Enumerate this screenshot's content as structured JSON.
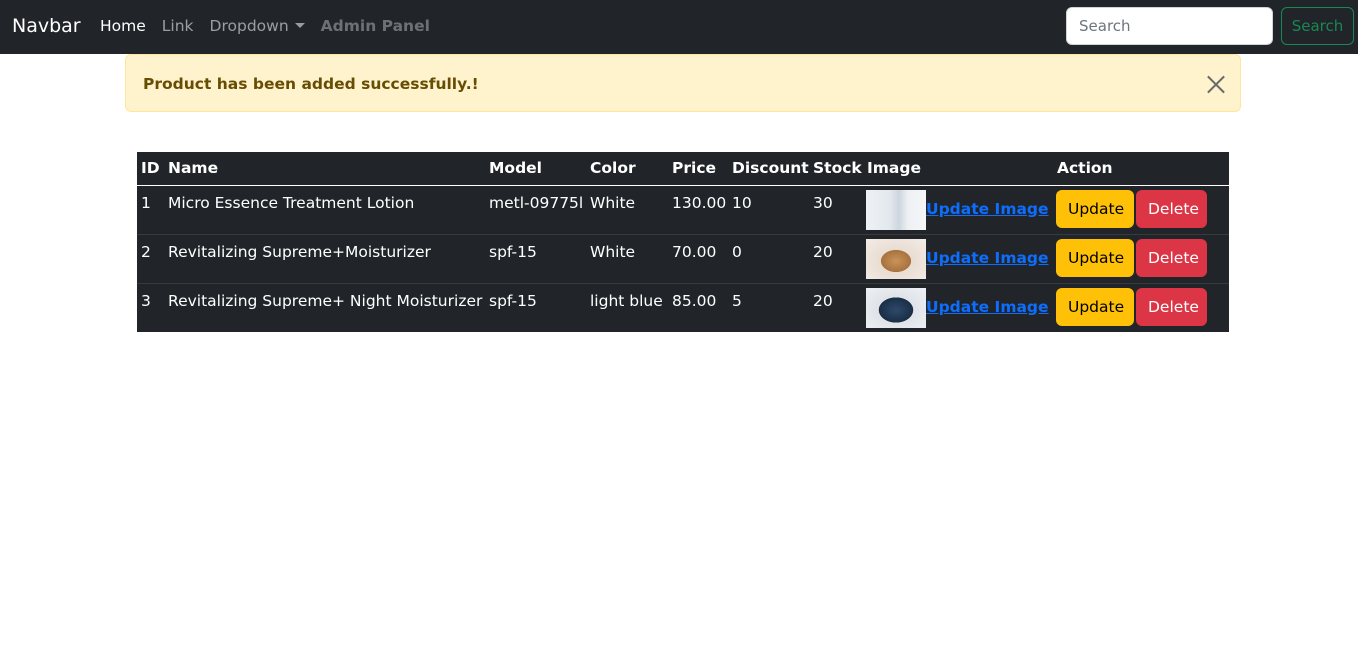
{
  "navbar": {
    "brand": "Navbar",
    "links": {
      "home": "Home",
      "link": "Link",
      "dropdown": "Dropdown",
      "admin": "Admin Panel"
    },
    "search_placeholder": "Search",
    "search_button": "Search"
  },
  "alert": {
    "message": "Product has been added successfully.!"
  },
  "table": {
    "headers": {
      "id": "ID",
      "name": "Name",
      "model": "Model",
      "color": "Color",
      "price": "Price",
      "discount": "Discount",
      "stock": "Stock",
      "image": "Image",
      "action": "Action"
    },
    "rows": [
      {
        "id": "1",
        "name": "Micro Essence Treatment Lotion",
        "model": "metl-09775l",
        "color": "White",
        "price": "130.00",
        "discount": "10",
        "stock": "30",
        "image_link": "Update Image",
        "update": "Update",
        "delete": "Delete"
      },
      {
        "id": "2",
        "name": "Revitalizing Supreme+Moisturizer",
        "model": "spf-15",
        "color": "White",
        "price": "70.00",
        "discount": "0",
        "stock": "20",
        "image_link": "Update Image",
        "update": "Update",
        "delete": "Delete"
      },
      {
        "id": "3",
        "name": "Revitalizing Supreme+ Night Moisturizer",
        "model": "spf-15",
        "color": "light blue",
        "price": "85.00",
        "discount": "5",
        "stock": "20",
        "image_link": "Update Image",
        "update": "Update",
        "delete": "Delete"
      }
    ]
  },
  "colors": {
    "navbar_bg": "#212529",
    "alert_bg": "#fff3cd",
    "alert_text": "#664d03",
    "link_blue": "#0d6efd",
    "warning": "#ffc107",
    "danger": "#dc3545",
    "success": "#198754"
  }
}
